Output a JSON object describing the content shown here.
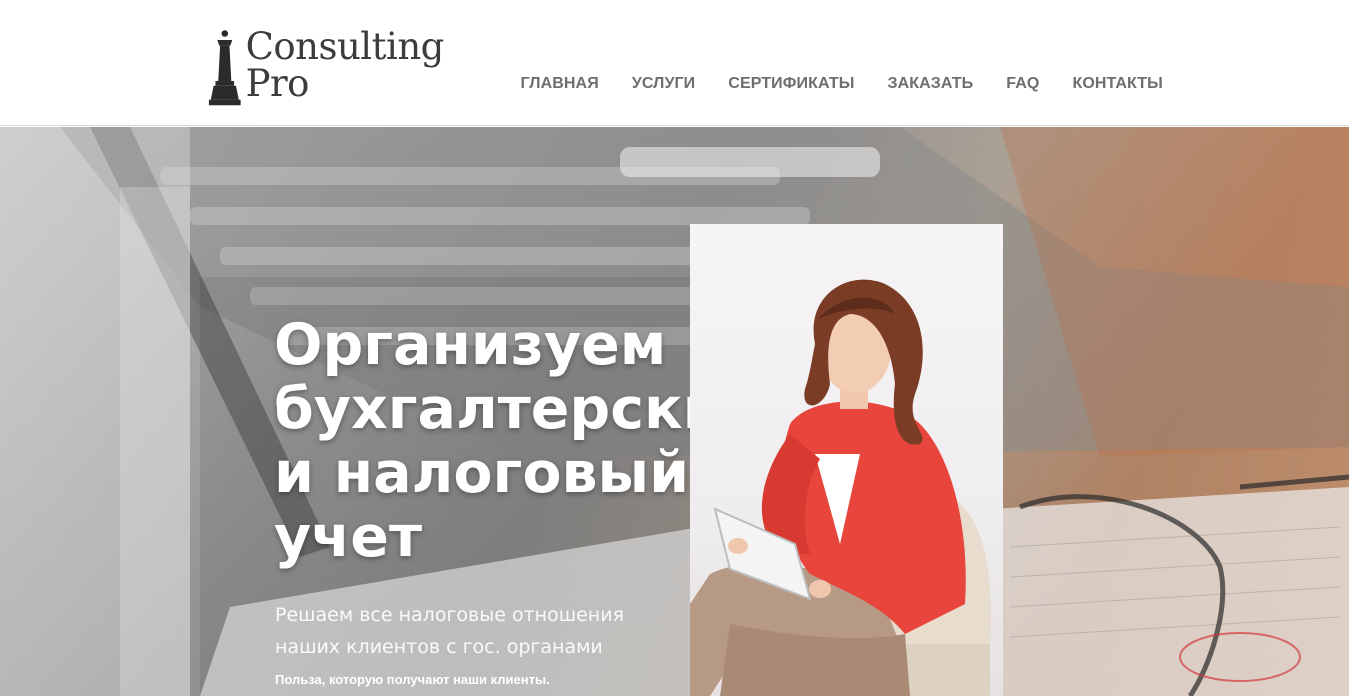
{
  "brand": {
    "name": "Consulting Pro",
    "logo_icon": "chess-queen-icon"
  },
  "nav": {
    "items": [
      {
        "label": "ГЛАВНАЯ"
      },
      {
        "label": "УСЛУГИ"
      },
      {
        "label": "СЕРТИФИКАТЫ"
      },
      {
        "label": "ЗАКАЗАТЬ"
      },
      {
        "label": "FAQ"
      },
      {
        "label": "КОНТАКТЫ"
      }
    ]
  },
  "hero": {
    "title": "Организуем\nбухгалтерский\nи налоговый\nучет",
    "subtitle": "Решаем все налоговые отношения\nнаших клиентов с гос. органами",
    "note": "Польза, которую получают наши клиенты."
  },
  "colors": {
    "nav_text": "#6e6e6e",
    "logo_text": "#3c3c3c",
    "jacket": "#e8453c"
  }
}
